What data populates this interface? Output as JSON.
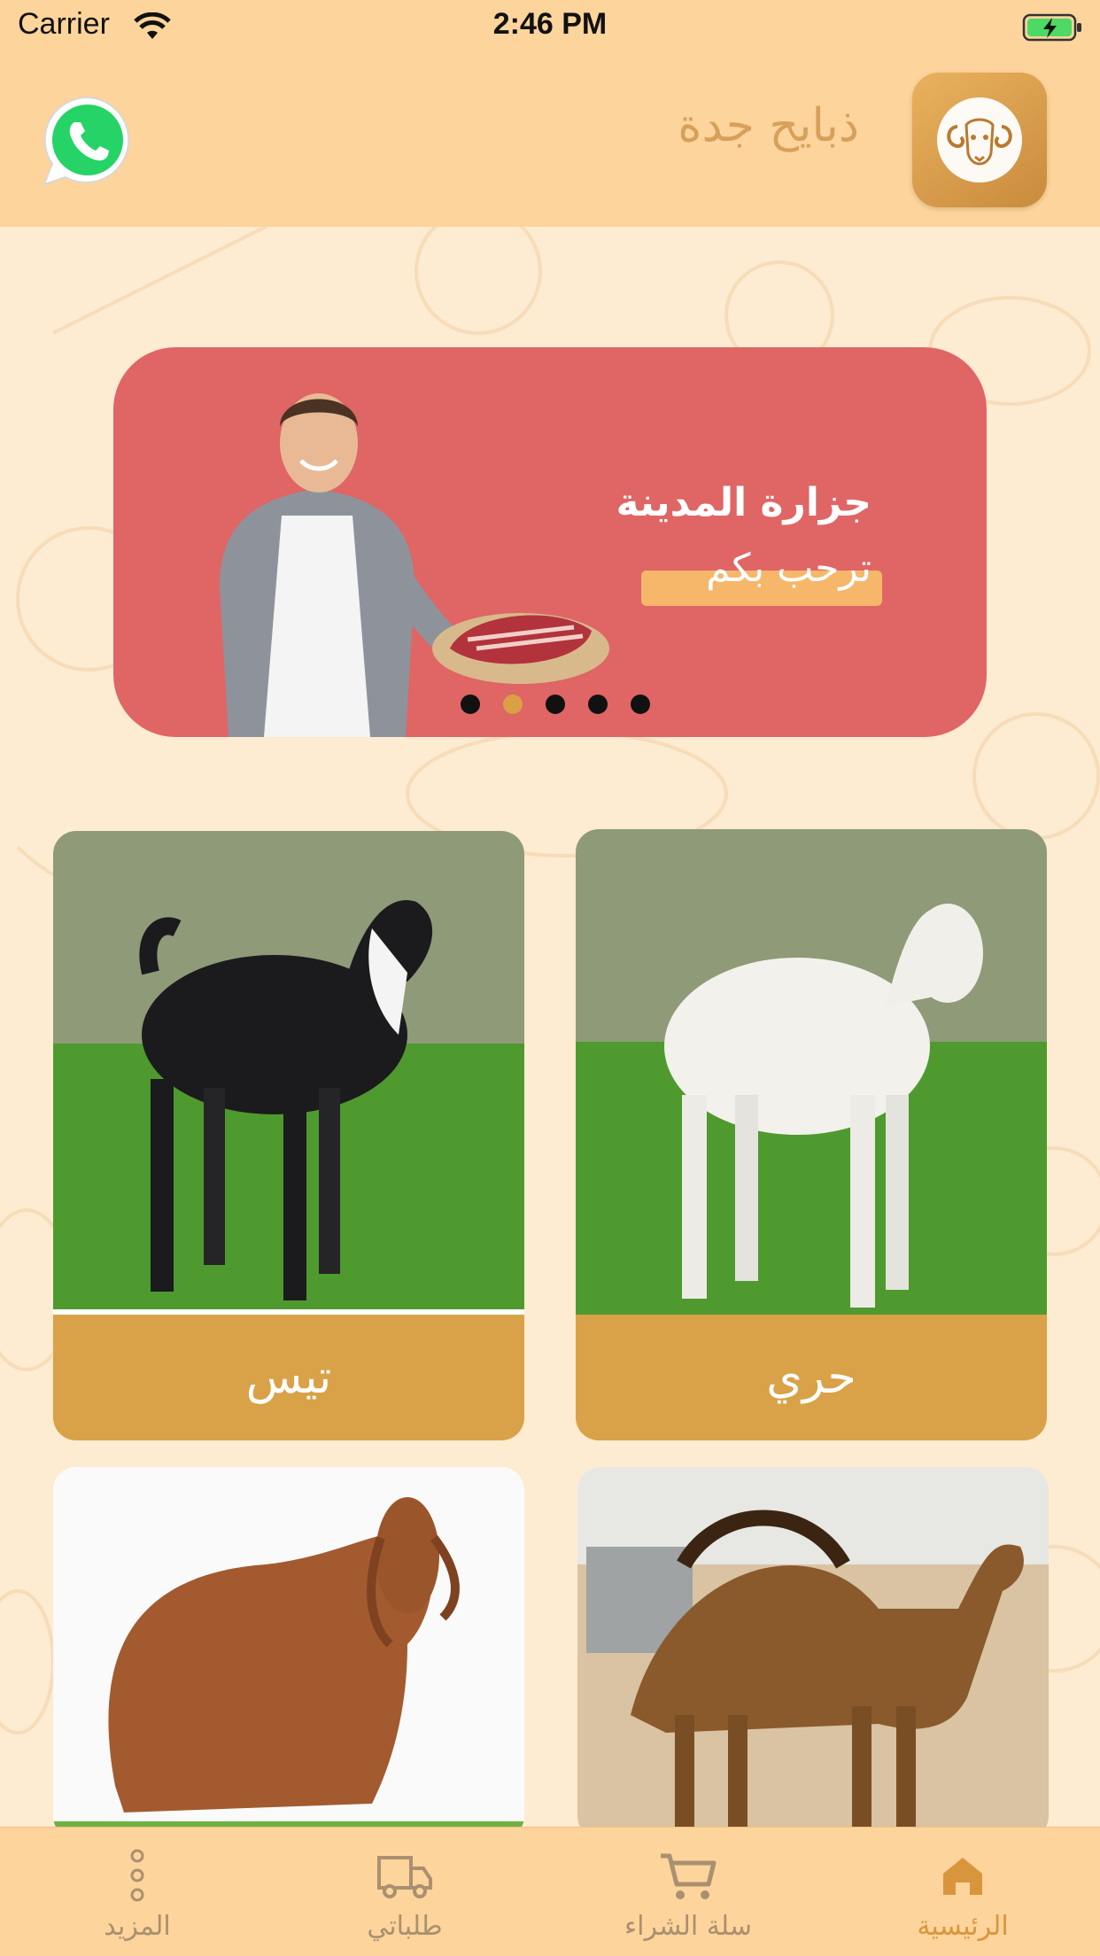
{
  "status_bar": {
    "carrier": "Carrier",
    "time": "2:46 PM"
  },
  "header": {
    "title": "ذبايح جدة",
    "logo_icon": "ram-head-icon",
    "whatsapp_icon": "whatsapp-icon"
  },
  "banner": {
    "headline": "جزارة المدينة",
    "subline": "ترحب بكم",
    "slides_count": 5,
    "active_slide": 2
  },
  "categories": [
    {
      "label": "حري",
      "image": "white-sheep-photo"
    },
    {
      "label": "تيس",
      "image": "black-goat-photo"
    },
    {
      "label": "",
      "image": "camel-photo"
    },
    {
      "label": "",
      "image": "brown-sheep-photo"
    }
  ],
  "tabbar": {
    "items": [
      {
        "label": "الرئيسية",
        "icon": "home-icon",
        "active": true
      },
      {
        "label": "سلة الشراء",
        "icon": "cart-icon",
        "active": false
      },
      {
        "label": "طلباتي",
        "icon": "truck-icon",
        "active": false
      },
      {
        "label": "المزيد",
        "icon": "more-dots-icon",
        "active": false
      }
    ]
  },
  "colors": {
    "header_bg": "#fdd49b",
    "page_bg": "#fdebd2",
    "banner_bg": "#e06565",
    "card_label_bg": "#d9a248",
    "accent": "#d9953e"
  }
}
